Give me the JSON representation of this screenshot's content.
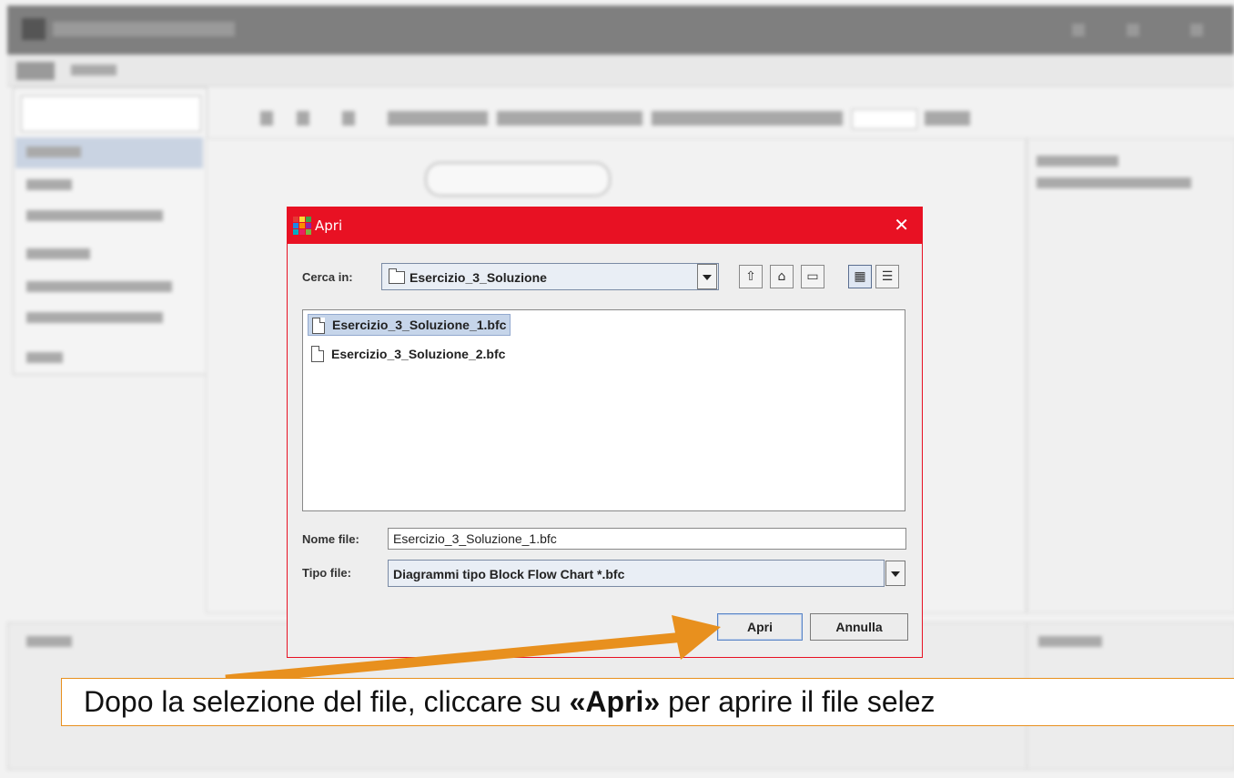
{
  "dialog": {
    "title": "Apri",
    "close_glyph": "✕",
    "look_in_label": "Cerca in:",
    "look_in_value": "Esercizio_3_Soluzione",
    "files": [
      {
        "name": "Esercizio_3_Soluzione_1.bfc",
        "selected": true
      },
      {
        "name": "Esercizio_3_Soluzione_2.bfc",
        "selected": false
      }
    ],
    "filename_label": "Nome file:",
    "filename_value": "Esercizio_3_Soluzione_1.bfc",
    "filetype_label": "Tipo file:",
    "filetype_value": "Diagrammi tipo Block Flow Chart *.bfc",
    "open_button": "Apri",
    "cancel_button": "Annulla",
    "toolbar_icons": [
      "up-folder-icon",
      "home-icon",
      "new-folder-icon",
      "list-view-icon",
      "details-view-icon"
    ]
  },
  "caption": {
    "before": "Dopo la selezione del file, cliccare su ",
    "bold": "«Apri»",
    "after": " per aprire il file selez"
  },
  "colors": {
    "title_bar": "#e81123",
    "arrow": "#e8901e",
    "selection": "#c6d5ea"
  }
}
